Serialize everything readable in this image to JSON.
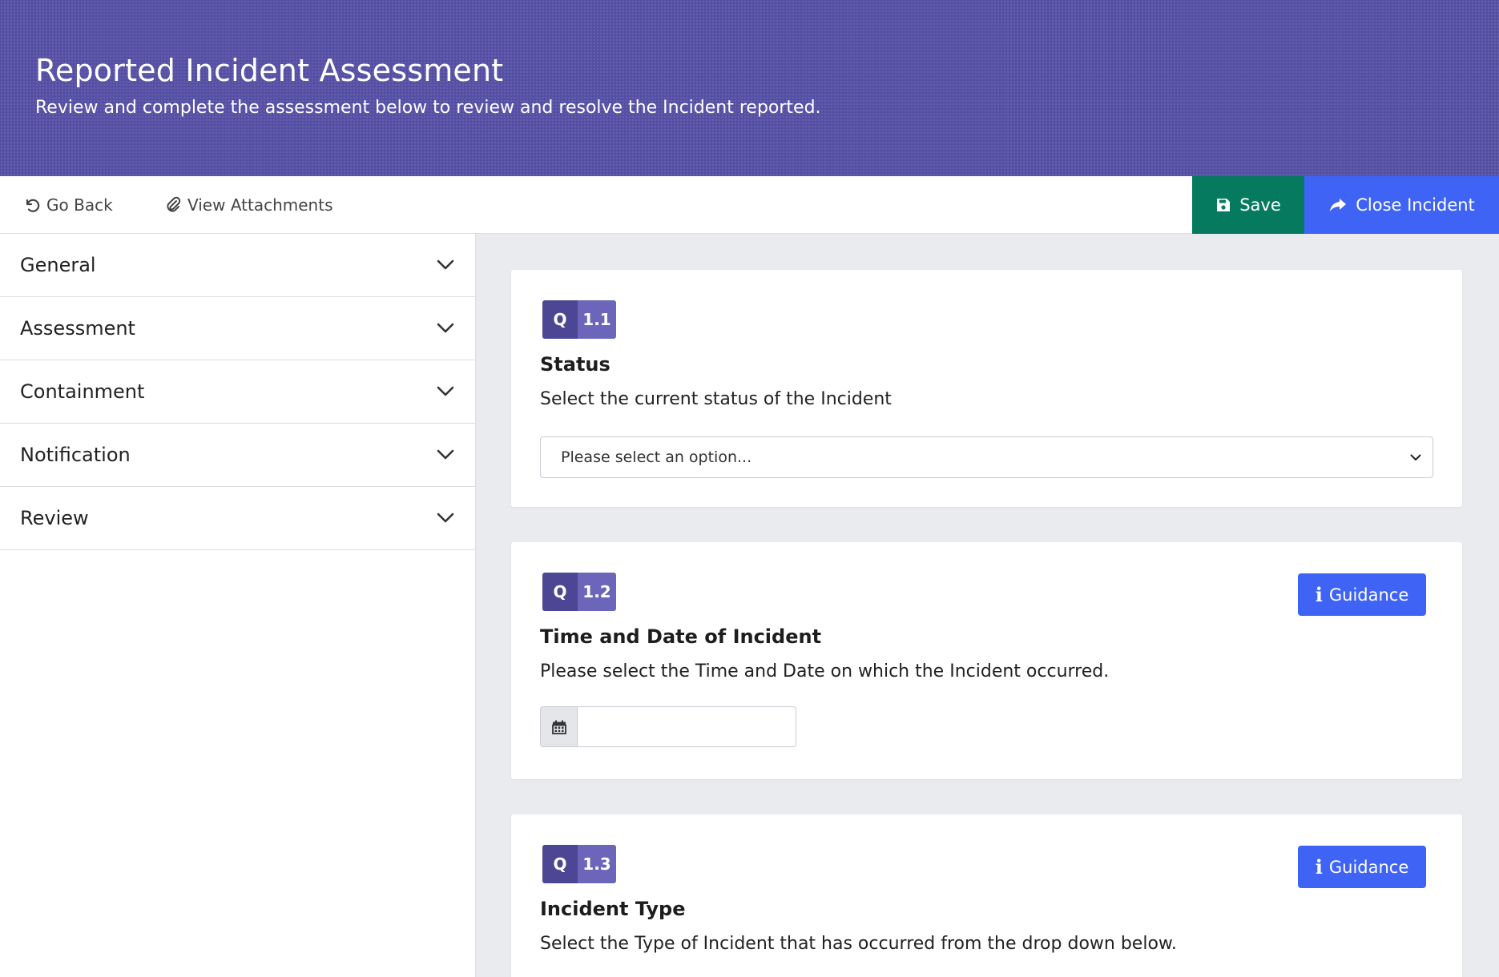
{
  "header": {
    "title": "Reported Incident Assessment",
    "subtitle": "Review and complete the assessment below to review and resolve the Incident reported."
  },
  "toolbar": {
    "go_back": "Go Back",
    "view_attachments": "View Attachments",
    "save": "Save",
    "close_incident": "Close Incident"
  },
  "sidebar": {
    "items": [
      {
        "label": "General"
      },
      {
        "label": "Assessment"
      },
      {
        "label": "Containment"
      },
      {
        "label": "Notification"
      },
      {
        "label": "Review"
      }
    ]
  },
  "questions": [
    {
      "badge_q": "Q",
      "number": "1.1",
      "title": "Status",
      "description": "Select the current status of the Incident",
      "select_value": "Please select an option..."
    },
    {
      "badge_q": "Q",
      "number": "1.2",
      "title": "Time and Date of Incident",
      "description": "Please select the Time and Date on which the Incident occurred.",
      "guidance": "Guidance",
      "date_value": ""
    },
    {
      "badge_q": "Q",
      "number": "1.3",
      "title": "Incident Type",
      "description": "Select the Type of Incident that has occurred from the drop down below.",
      "guidance": "Guidance"
    }
  ],
  "colors": {
    "header_bg": "#5550a4",
    "save_bg": "#067a5f",
    "primary_blue": "#3e63f5",
    "badge_dark": "#4b4795",
    "badge_light": "#6b66ba"
  },
  "icons": {
    "go_back": "undo-icon",
    "attachments": "paperclip-icon",
    "save": "floppy-disk-icon",
    "close": "share-arrow-icon",
    "guidance": "info-icon",
    "calendar": "calendar-icon",
    "accordion": "chevron-down-icon"
  }
}
